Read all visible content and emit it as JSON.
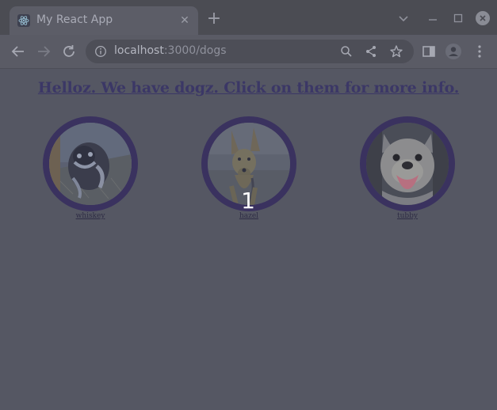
{
  "browser": {
    "tab_title": "My React App",
    "url_host": "localhost",
    "url_path": ":3000/dogs"
  },
  "page": {
    "headline": "Helloz. We have dogz. Click on them for more info.",
    "dogs": [
      {
        "name": "whiskey"
      },
      {
        "name": "hazel"
      },
      {
        "name": "tubby"
      }
    ],
    "overlay_number": "1"
  },
  "colors": {
    "background": "#555763",
    "accent_ring": "#3a325f",
    "headline": "#3b3766"
  }
}
